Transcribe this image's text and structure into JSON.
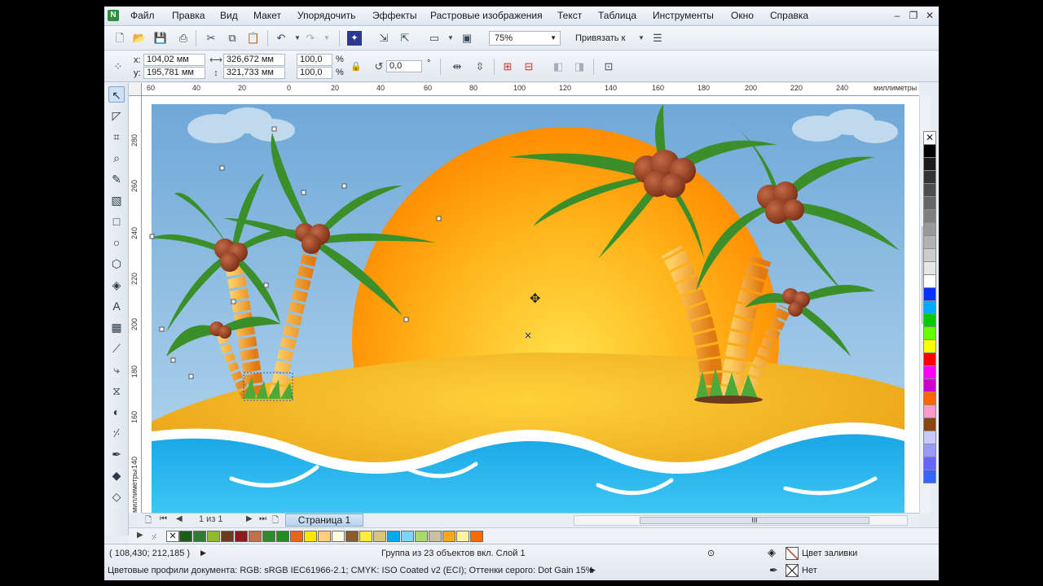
{
  "menu": {
    "items": [
      "Файл",
      "Правка",
      "Вид",
      "Макет",
      "Упорядочить",
      "Эффекты",
      "Растровые изображения",
      "Текст",
      "Таблица",
      "Инструменты",
      "Окно",
      "Справка"
    ]
  },
  "toolbar": {
    "zoom": "75%",
    "snap_label": "Привязать к"
  },
  "property_bar": {
    "x_label": "x:",
    "x_value": "104,02 мм",
    "y_label": "y:",
    "y_value": "195,781 мм",
    "width_value": "326,672 мм",
    "height_value": "321,733 мм",
    "scale_x": "100,0",
    "scale_y": "100,0",
    "percent": "%",
    "rotation": "0,0",
    "degree": "°"
  },
  "rulers": {
    "h_labels": [
      "60",
      "40",
      "20",
      "0",
      "20",
      "40",
      "60",
      "80",
      "100",
      "120",
      "140",
      "160",
      "180",
      "200",
      "220",
      "240"
    ],
    "h_units": "миллиметры",
    "v_labels": [
      "280",
      "260",
      "240",
      "220",
      "200",
      "180",
      "160",
      "140"
    ],
    "v_units": "миллиметры"
  },
  "page_nav": {
    "counter": "1 из 1",
    "page_tab": "Страница 1",
    "hscroll_grip": "III"
  },
  "status": {
    "coords": "( 108,430; 212,185 )",
    "selection": "Группа из 23 объектов вкл. Слой 1",
    "color_profiles": "Цветовые профили документа: RGB: sRGB IEC61966-2.1; CMYK: ISO Coated v2 (ECI); Оттенки серого: Dot Gain 15%",
    "fill_label": "Цвет заливки",
    "outline_label": "Нет"
  },
  "palette_vertical": [
    "#000000",
    "#1a1a1a",
    "#333333",
    "#4d4d4d",
    "#666666",
    "#808080",
    "#999999",
    "#b3b3b3",
    "#cccccc",
    "#e6e6e6",
    "#ffffff",
    "#0033ff",
    "#00aaff",
    "#00cc00",
    "#66ff00",
    "#ffff00",
    "#ff0000",
    "#ff00ff",
    "#cc00cc",
    "#ff6600",
    "#ff99cc",
    "#8b4513",
    "#c8c8ff",
    "#9999ff",
    "#6666ff",
    "#3366ff"
  ],
  "palette_horizontal": [
    "#1a5c1a",
    "#2f7d32",
    "#8fbc2f",
    "#6b3a1f",
    "#8b1a1a",
    "#c0724a",
    "#2e8b2e",
    "#228b22",
    "#e8651a",
    "#ffe600",
    "#ffcc80",
    "#fffde0",
    "#8b5a2b",
    "#ffeb3b",
    "#d9c47a",
    "#00aaee",
    "#7fd4f5",
    "#a8d86e",
    "#c8c0a0",
    "#f5a623",
    "#fff2a0",
    "#ff6a00"
  ]
}
